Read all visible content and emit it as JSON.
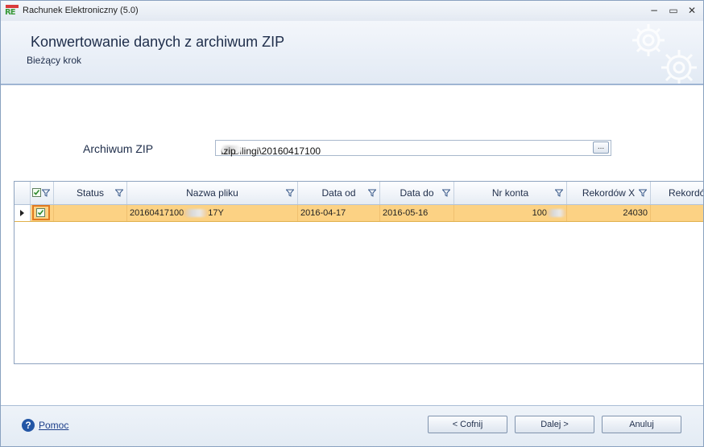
{
  "window": {
    "title": "Rachunek Elektroniczny (5.0)",
    "logo_text": "RE",
    "controls": {
      "minimize": "−",
      "restore": "▭",
      "close": "✕"
    }
  },
  "header": {
    "title": "Konwertowanie danych z archiwum ZIP",
    "subtitle": "Bieżący krok"
  },
  "form": {
    "zip_label": "Archiwum ZIP",
    "zip_path": "C:\\Bilingi\\20160417100",
    "zip_path_suffix": ".zip",
    "browse_label": "..."
  },
  "grid": {
    "columns": [
      "Status",
      "Nazwa pliku",
      "Data od",
      "Data do",
      "Nr konta",
      "Rekordów X",
      "Rekordó"
    ],
    "rows": [
      {
        "selected": true,
        "checked": true,
        "status": "",
        "file_name_prefix": "20160417100",
        "file_name_suffix": "17Y",
        "date_from": "2016-04-17",
        "date_to": "2016-05-16",
        "account_prefix": "100",
        "records_x": "24030"
      }
    ]
  },
  "footer": {
    "help_icon": "?",
    "help_label": "Pomoc",
    "back_label": "<   Cofnij",
    "next_label": "Dalej   >",
    "cancel_label": "Anuluj"
  },
  "colors": {
    "selected_row": "#fcd284",
    "header_bg": "#e2eaf4",
    "accent": "#2356a5"
  }
}
